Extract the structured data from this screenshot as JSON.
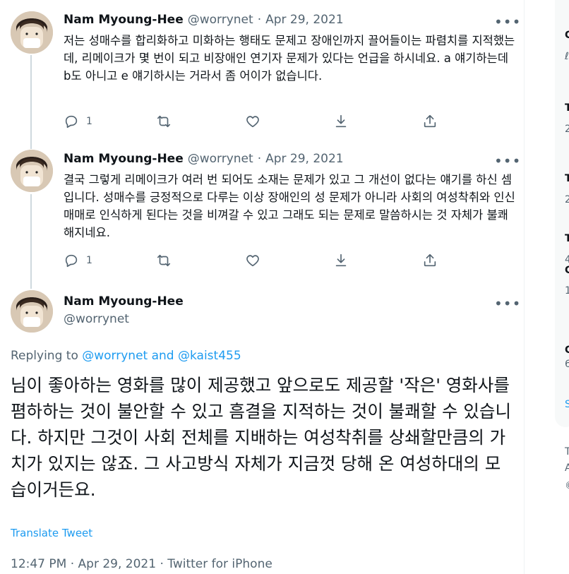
{
  "author": {
    "name": "Nam Myoung-Hee",
    "handle": "@worrynet"
  },
  "tweets": [
    {
      "name": "Nam Myoung-Hee",
      "handle": "@worrynet",
      "separator": "·",
      "date": "Apr 29, 2021",
      "text": "저는 성매수를 합리화하고 미화하는 행태도 문제고 장애인까지 끌어들이는 파렴치를 지적했는데, 리메이크가 몇 번이 되고 비장애인 연기자 문제가 있다는 언급을 하시네요. a 얘기하는데 b도 아니고 e 얘기하시는 거라서 좀 어이가 없습니다.",
      "reply_count": "1"
    },
    {
      "name": "Nam Myoung-Hee",
      "handle": "@worrynet",
      "separator": "·",
      "date": "Apr 29, 2021",
      "text": "결국 그렇게 리메이크가 여러 번 되어도 소재는 문제가 있고 그 개선이 없다는 얘기를 하신 셈입니다. 성매수를 긍정적으로 다루는 이상 장애인의 성 문제가 아니라 사회의 여성착취와 인신매매로 인식하게 된다는 것을 비껴갈 수 있고 그래도 되는 문제로 말씀하시는 것 자체가 불쾌해지네요.",
      "reply_count": "1"
    }
  ],
  "main_tweet": {
    "name": "Nam Myoung-Hee",
    "handle": "@worrynet",
    "replying_prefix": "Replying to",
    "replying_links": "@worrynet and @kaist455",
    "text": "님이 좋아하는 영화를 많이 제공했고 앞으로도 제공할 '작은' 영화사를 폄하하는 것이 불안할 수 있고 흠결을 지적하는 것이 불쾌할 수 있습니다. 하지만 그것이 사회 전체를 지배하는 여성착취를 상쇄할만큼의 가치가 있지는 않죠. 그 사고방식 자체가 지금껏 당해 온 여성하대의 모습이거든요.",
    "translate_label": "Translate Tweet",
    "meta": "12:47 PM · Apr 29, 2021 · Twitter for iPhone"
  },
  "sidebar_fragments": [
    "C",
    "ℓ",
    "T",
    "2",
    "T",
    "2",
    "T",
    "4",
    "C",
    "1",
    "C",
    "6",
    "S",
    "T",
    "A",
    "©"
  ],
  "icons": {
    "more": "more-dots-icon",
    "reply": "reply-icon",
    "retweet": "retweet-icon",
    "like": "heart-icon",
    "download": "download-icon",
    "share": "share-icon"
  },
  "colors": {
    "text": "#0f1419",
    "muted": "#536471",
    "link": "#1d9bf0",
    "thread_line": "#cfd9de"
  }
}
